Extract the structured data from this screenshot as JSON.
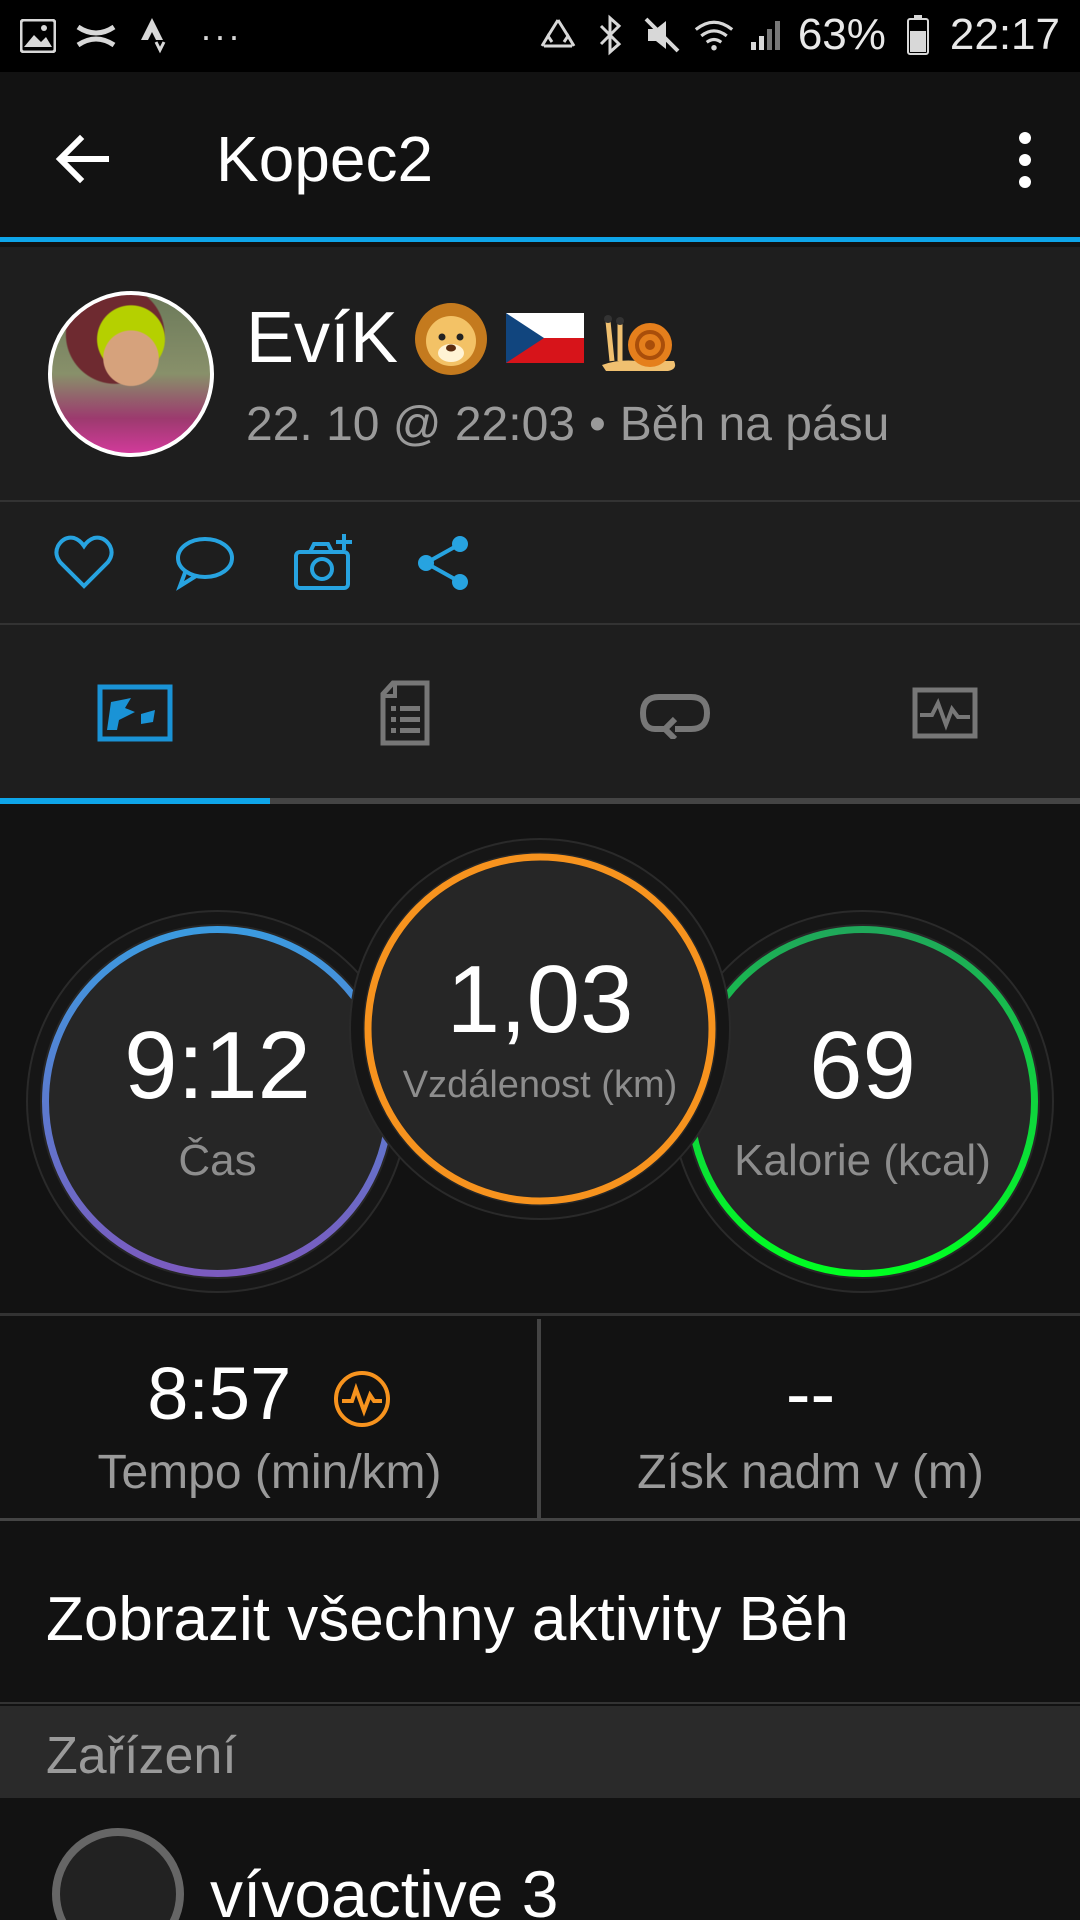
{
  "status_bar": {
    "battery": "63%",
    "time": "22:17",
    "left_icons": [
      "image-icon",
      "under-armour-icon",
      "strava-icon"
    ],
    "more": "···"
  },
  "app_bar": {
    "title": "Kopec2"
  },
  "profile": {
    "name": "EvíK",
    "date": "22. 10 @ 22:03",
    "separator": "•",
    "activity_type": "Běh na pásu"
  },
  "stats": {
    "time": {
      "value": "9:12",
      "label": "Čas"
    },
    "distance": {
      "value": "1,03",
      "label": "Vzdálenost (km)"
    },
    "calories": {
      "value": "69",
      "label": "Kalorie (kcal)"
    },
    "pace": {
      "value": "8:57",
      "label": "Tempo (min/km)"
    },
    "elevation": {
      "value": "--",
      "label": "Získ nadm v (m)"
    }
  },
  "all_activities": "Zobrazit všechny aktivity Běh",
  "section_header": "Zařízení",
  "device": {
    "name": "vívoactive 3"
  },
  "colors": {
    "accent": "#0ea5e9",
    "time_ring": [
      "#3b9be0",
      "#7b5bbf"
    ],
    "distance_ring": "#f7931e",
    "calories_ring": [
      "#1fd05a",
      "#00ff22"
    ],
    "pace_icon": "#f7931e"
  }
}
